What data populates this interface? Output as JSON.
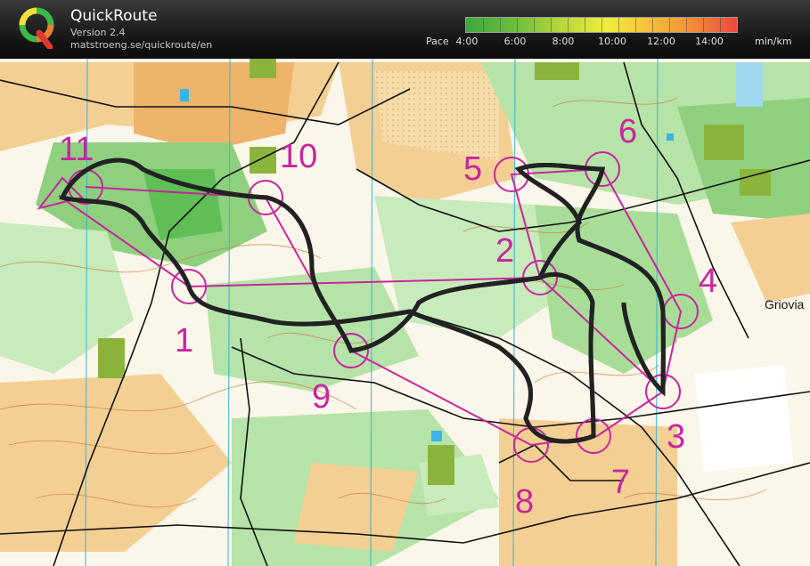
{
  "app": {
    "title": "QuickRoute",
    "version": "Version 2.4",
    "url": "matstroeng.se/quickroute/en"
  },
  "pace_scale": {
    "label": "Pace",
    "unit": "min/km",
    "ticks": [
      "4:00",
      "6:00",
      "8:00",
      "10:00",
      "12:00",
      "14:00"
    ],
    "colors": [
      "#3fa63f",
      "#b9d93a",
      "#f0ee3c",
      "#f29a3a",
      "#ea4a3b"
    ]
  },
  "map": {
    "place_name": "Griovia",
    "course_color": "#c8259f",
    "route_color": "#2f2f2f",
    "controls": [
      {
        "number": "1"
      },
      {
        "number": "2"
      },
      {
        "number": "3"
      },
      {
        "number": "4"
      },
      {
        "number": "5"
      },
      {
        "number": "6"
      },
      {
        "number": "7"
      },
      {
        "number": "8"
      },
      {
        "number": "9"
      },
      {
        "number": "10"
      },
      {
        "number": "11"
      }
    ]
  }
}
